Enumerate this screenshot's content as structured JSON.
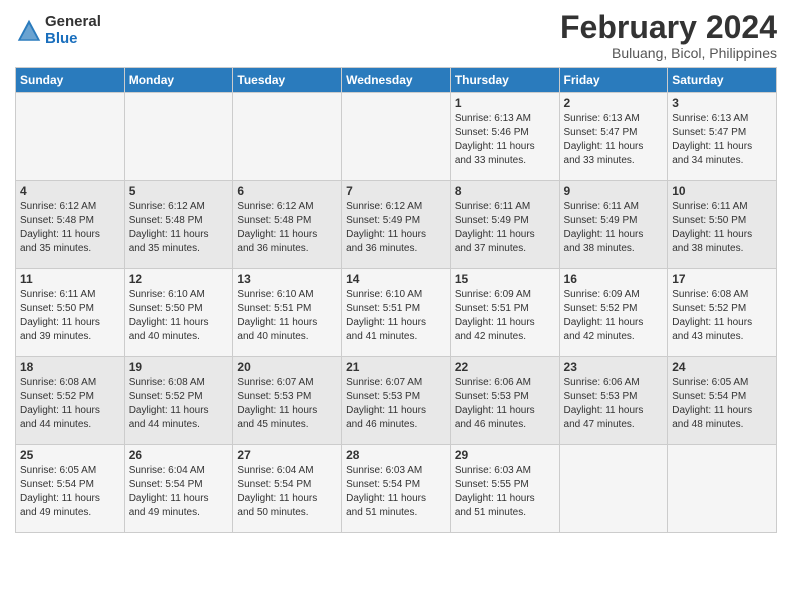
{
  "logo": {
    "general": "General",
    "blue": "Blue"
  },
  "title": "February 2024",
  "location": "Buluang, Bicol, Philippines",
  "headers": [
    "Sunday",
    "Monday",
    "Tuesday",
    "Wednesday",
    "Thursday",
    "Friday",
    "Saturday"
  ],
  "weeks": [
    [
      {
        "day": "",
        "info": ""
      },
      {
        "day": "",
        "info": ""
      },
      {
        "day": "",
        "info": ""
      },
      {
        "day": "",
        "info": ""
      },
      {
        "day": "1",
        "info": "Sunrise: 6:13 AM\nSunset: 5:46 PM\nDaylight: 11 hours\nand 33 minutes."
      },
      {
        "day": "2",
        "info": "Sunrise: 6:13 AM\nSunset: 5:47 PM\nDaylight: 11 hours\nand 33 minutes."
      },
      {
        "day": "3",
        "info": "Sunrise: 6:13 AM\nSunset: 5:47 PM\nDaylight: 11 hours\nand 34 minutes."
      }
    ],
    [
      {
        "day": "4",
        "info": "Sunrise: 6:12 AM\nSunset: 5:48 PM\nDaylight: 11 hours\nand 35 minutes."
      },
      {
        "day": "5",
        "info": "Sunrise: 6:12 AM\nSunset: 5:48 PM\nDaylight: 11 hours\nand 35 minutes."
      },
      {
        "day": "6",
        "info": "Sunrise: 6:12 AM\nSunset: 5:48 PM\nDaylight: 11 hours\nand 36 minutes."
      },
      {
        "day": "7",
        "info": "Sunrise: 6:12 AM\nSunset: 5:49 PM\nDaylight: 11 hours\nand 36 minutes."
      },
      {
        "day": "8",
        "info": "Sunrise: 6:11 AM\nSunset: 5:49 PM\nDaylight: 11 hours\nand 37 minutes."
      },
      {
        "day": "9",
        "info": "Sunrise: 6:11 AM\nSunset: 5:49 PM\nDaylight: 11 hours\nand 38 minutes."
      },
      {
        "day": "10",
        "info": "Sunrise: 6:11 AM\nSunset: 5:50 PM\nDaylight: 11 hours\nand 38 minutes."
      }
    ],
    [
      {
        "day": "11",
        "info": "Sunrise: 6:11 AM\nSunset: 5:50 PM\nDaylight: 11 hours\nand 39 minutes."
      },
      {
        "day": "12",
        "info": "Sunrise: 6:10 AM\nSunset: 5:50 PM\nDaylight: 11 hours\nand 40 minutes."
      },
      {
        "day": "13",
        "info": "Sunrise: 6:10 AM\nSunset: 5:51 PM\nDaylight: 11 hours\nand 40 minutes."
      },
      {
        "day": "14",
        "info": "Sunrise: 6:10 AM\nSunset: 5:51 PM\nDaylight: 11 hours\nand 41 minutes."
      },
      {
        "day": "15",
        "info": "Sunrise: 6:09 AM\nSunset: 5:51 PM\nDaylight: 11 hours\nand 42 minutes."
      },
      {
        "day": "16",
        "info": "Sunrise: 6:09 AM\nSunset: 5:52 PM\nDaylight: 11 hours\nand 42 minutes."
      },
      {
        "day": "17",
        "info": "Sunrise: 6:08 AM\nSunset: 5:52 PM\nDaylight: 11 hours\nand 43 minutes."
      }
    ],
    [
      {
        "day": "18",
        "info": "Sunrise: 6:08 AM\nSunset: 5:52 PM\nDaylight: 11 hours\nand 44 minutes."
      },
      {
        "day": "19",
        "info": "Sunrise: 6:08 AM\nSunset: 5:52 PM\nDaylight: 11 hours\nand 44 minutes."
      },
      {
        "day": "20",
        "info": "Sunrise: 6:07 AM\nSunset: 5:53 PM\nDaylight: 11 hours\nand 45 minutes."
      },
      {
        "day": "21",
        "info": "Sunrise: 6:07 AM\nSunset: 5:53 PM\nDaylight: 11 hours\nand 46 minutes."
      },
      {
        "day": "22",
        "info": "Sunrise: 6:06 AM\nSunset: 5:53 PM\nDaylight: 11 hours\nand 46 minutes."
      },
      {
        "day": "23",
        "info": "Sunrise: 6:06 AM\nSunset: 5:53 PM\nDaylight: 11 hours\nand 47 minutes."
      },
      {
        "day": "24",
        "info": "Sunrise: 6:05 AM\nSunset: 5:54 PM\nDaylight: 11 hours\nand 48 minutes."
      }
    ],
    [
      {
        "day": "25",
        "info": "Sunrise: 6:05 AM\nSunset: 5:54 PM\nDaylight: 11 hours\nand 49 minutes."
      },
      {
        "day": "26",
        "info": "Sunrise: 6:04 AM\nSunset: 5:54 PM\nDaylight: 11 hours\nand 49 minutes."
      },
      {
        "day": "27",
        "info": "Sunrise: 6:04 AM\nSunset: 5:54 PM\nDaylight: 11 hours\nand 50 minutes."
      },
      {
        "day": "28",
        "info": "Sunrise: 6:03 AM\nSunset: 5:54 PM\nDaylight: 11 hours\nand 51 minutes."
      },
      {
        "day": "29",
        "info": "Sunrise: 6:03 AM\nSunset: 5:55 PM\nDaylight: 11 hours\nand 51 minutes."
      },
      {
        "day": "",
        "info": ""
      },
      {
        "day": "",
        "info": ""
      }
    ]
  ]
}
